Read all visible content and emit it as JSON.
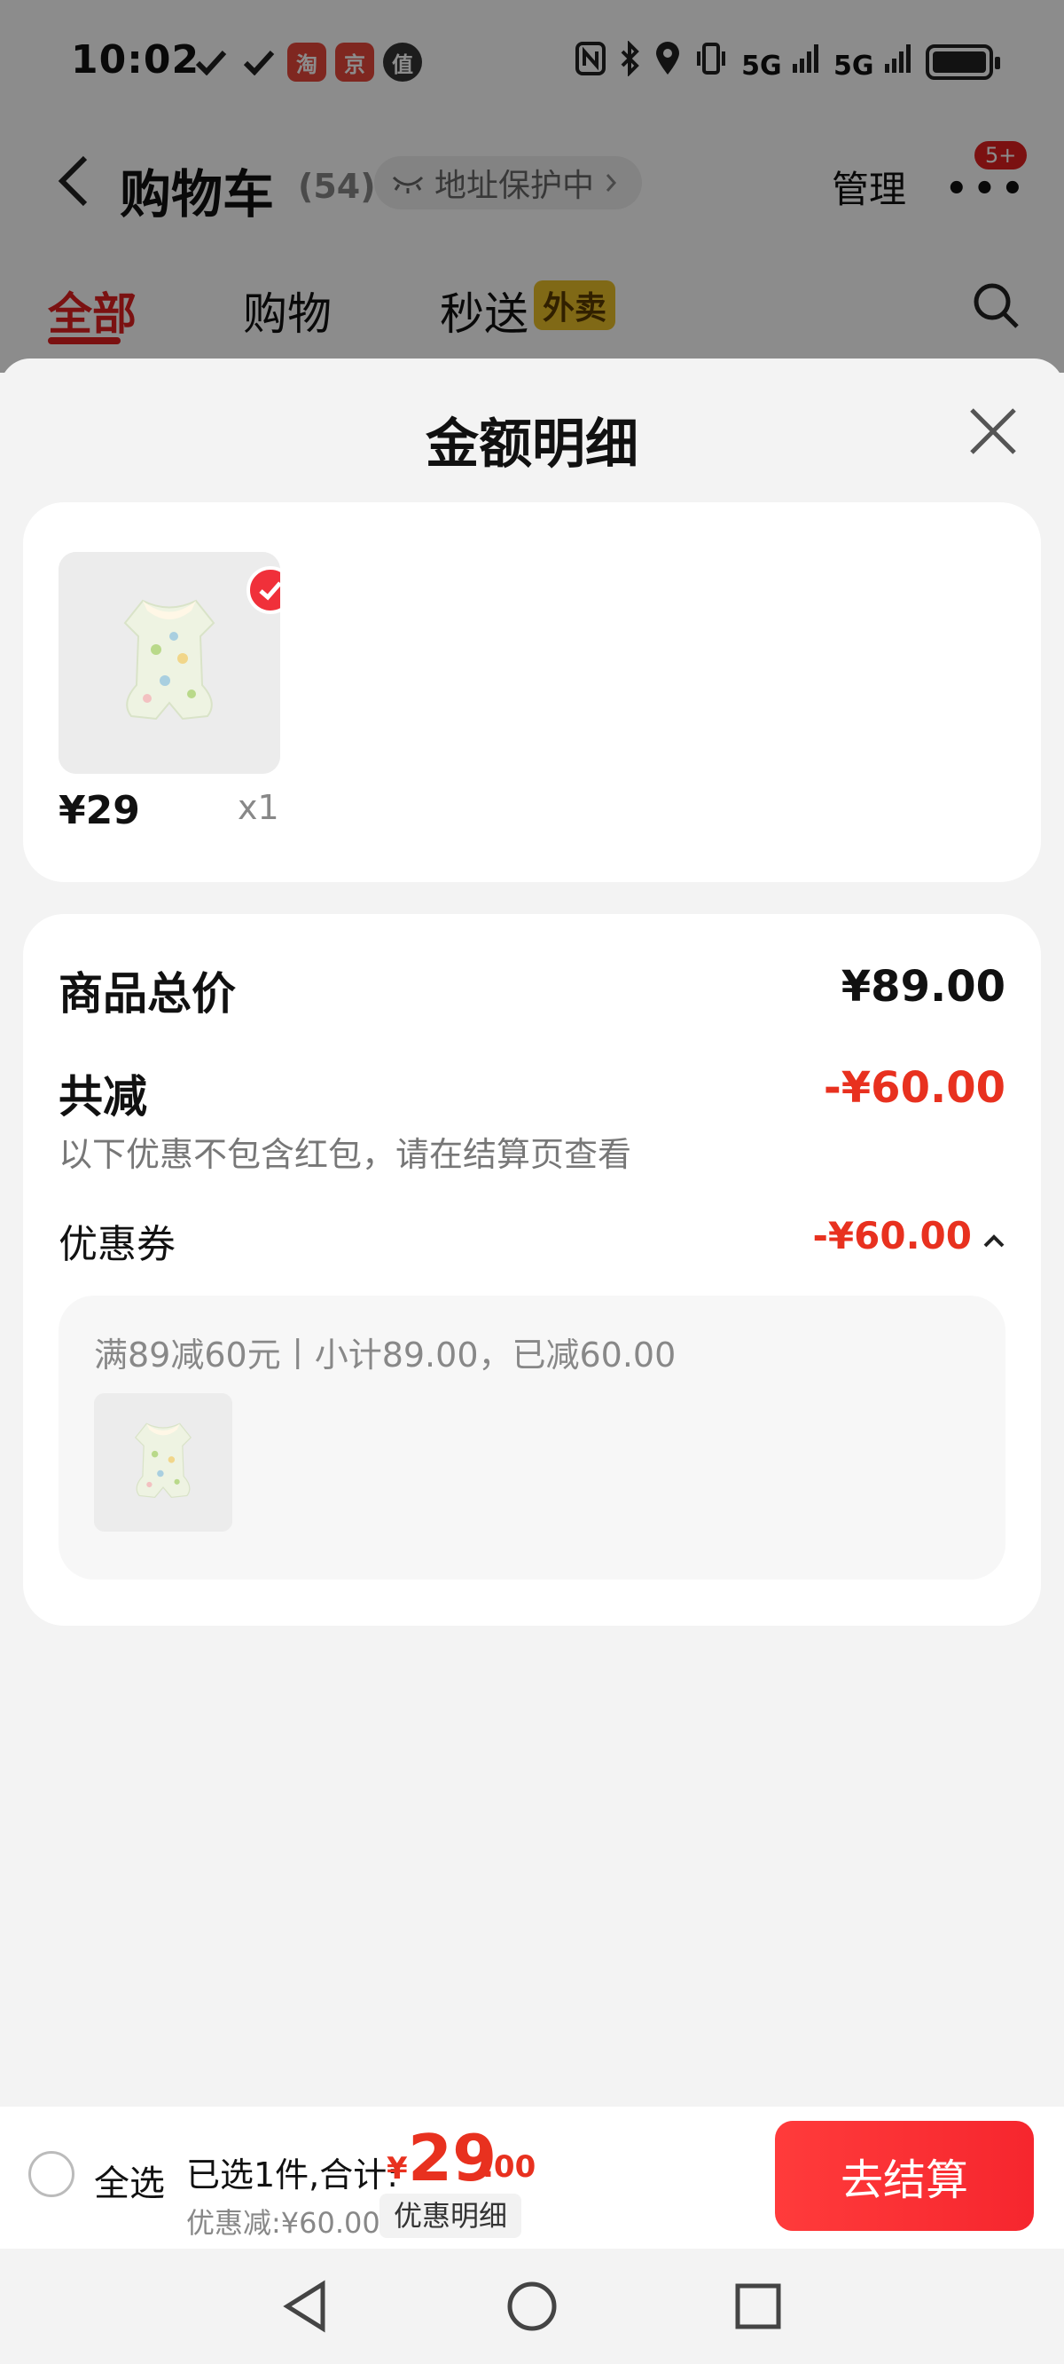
{
  "status_bar": {
    "time": "10:02",
    "left_icons": [
      "check-icon",
      "check-icon",
      "taobao-app-icon",
      "jd-app-icon",
      "zhi-app-icon"
    ],
    "app_icon_taobao": "淘",
    "app_icon_jd": "京",
    "app_icon_zhi": "值",
    "network_5g_1": "5G",
    "network_5g_2": "5G"
  },
  "header": {
    "title": "购物车",
    "count": "(54)",
    "address_protect": "地址保护中",
    "manage": "管理",
    "more": "•••",
    "badge": "5+"
  },
  "tabs": [
    {
      "label": "全部",
      "active": true
    },
    {
      "label": "购物",
      "active": false
    },
    {
      "label": "秒送",
      "active": false
    }
  ],
  "tab_badge": "外卖",
  "sheet": {
    "title": "金额明细",
    "item": {
      "price": "¥29",
      "qty": "x1"
    },
    "total_label": "商品总价",
    "total_value": "¥89.00",
    "reduce_label": "共减",
    "reduce_value": "-¥60.00",
    "reduce_note": "以下优惠不包含红包，请在结算页查看",
    "coupon_label": "优惠券",
    "coupon_value": "-¥60.00",
    "coupon_desc": "满89减60元丨小计89.00，已减60.00"
  },
  "bottom_bar": {
    "select_all": "全选",
    "summary": "已选1件,合计:",
    "currency": "¥",
    "total_int": "29",
    "total_dec": ".00",
    "discount": "优惠减:¥60.00",
    "detail_link": "优惠明细",
    "checkout": "去结算"
  },
  "colors": {
    "accent": "#e8311f",
    "tab_badge": "#e9c028"
  }
}
